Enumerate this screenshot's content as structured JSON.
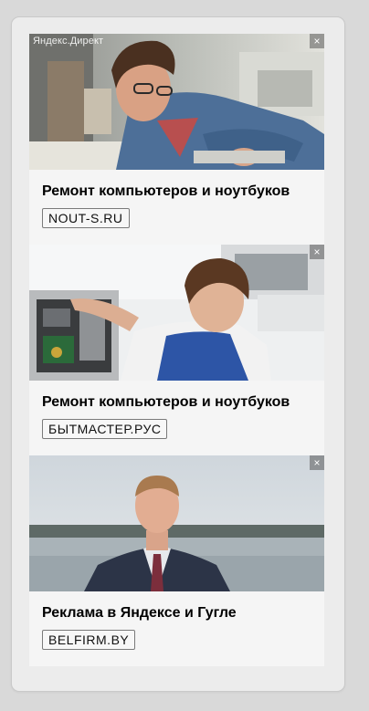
{
  "widget": {
    "source_label": "Яндекс.Директ",
    "close_glyph": "×"
  },
  "ads": [
    {
      "title": "Ремонт компьютеров и ноутбуков",
      "domain": "NOUT-S.RU",
      "image_icon": "technician-repairing-laptop-image"
    },
    {
      "title": "Ремонт компьютеров и ноутбуков",
      "domain": "БЫТМАСТЕР.РУС",
      "image_icon": "technician-repairing-desktop-pc-image"
    },
    {
      "title": "Реклама в Яндексе и Гугле",
      "domain": "BELFIRM.BY",
      "image_icon": "businessman-by-lake-image"
    }
  ],
  "colors": {
    "page_background": "#d9d9d9",
    "panel_background": "#ececec",
    "card_background": "#f5f5f5",
    "title_text": "#000000",
    "domain_border": "#7a7a7a"
  }
}
